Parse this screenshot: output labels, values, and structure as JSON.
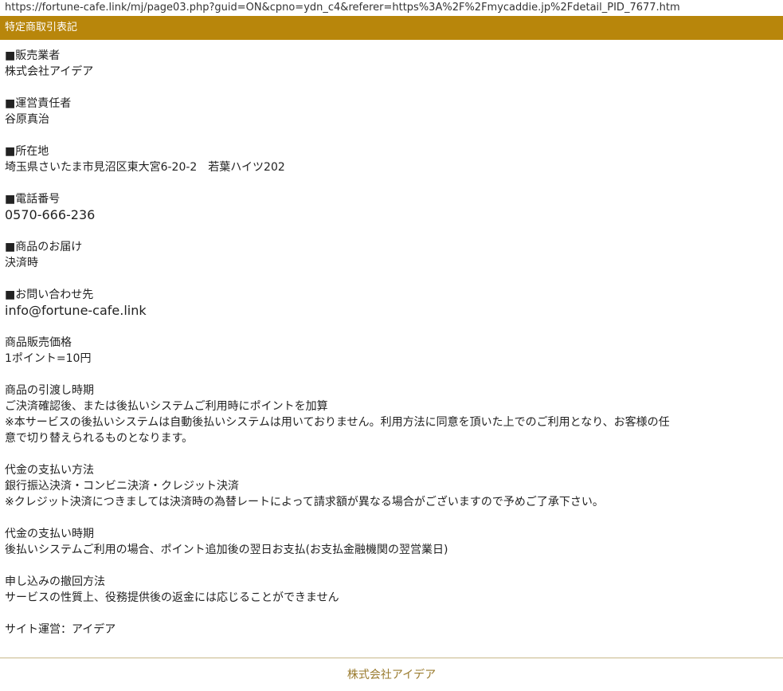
{
  "browser": {
    "url": "https://fortune-cafe.link/mj/page03.php?guid=ON&cpno=ydn_c4&referer=https%3A%2F%2Fmycaddie.jp%2Fdetail_PID_7677.htm"
  },
  "header": {
    "title": "特定商取引表記"
  },
  "sections": {
    "seller": {
      "heading": "■販売業者",
      "lines": [
        "株式会社アイデア"
      ]
    },
    "manager": {
      "heading": "■運営責任者",
      "lines": [
        "谷原真治"
      ]
    },
    "address": {
      "heading": "■所在地",
      "lines": [
        "埼玉県さいたま市見沼区東大宮6-20-2　若葉ハイツ202"
      ]
    },
    "phone": {
      "heading": "■電話番号",
      "lines": [
        "0570-666-236"
      ]
    },
    "delivery": {
      "heading": "■商品のお届け",
      "lines": [
        "決済時"
      ]
    },
    "contact": {
      "heading": "■お問い合わせ先",
      "lines": [
        "info@fortune-cafe.link"
      ]
    },
    "price": {
      "heading": "商品販売価格",
      "lines": [
        "1ポイント=10円"
      ]
    },
    "handover": {
      "heading": "商品の引渡し時期",
      "lines": [
        "ご決済確認後、または後払いシステムご利用時にポイントを加算",
        "※本サービスの後払いシステムは自動後払いシステムは用いておりません。利用方法に同意を頂いた上でのご利用となり、お客様の任",
        "意で切り替えられるものとなります。"
      ]
    },
    "payment_method": {
      "heading": "代金の支払い方法",
      "lines": [
        "銀行振込決済・コンビニ決済・クレジット決済",
        "※クレジット決済につきましては決済時の為替レートによって請求額が異なる場合がございますので予めご了承下さい。"
      ]
    },
    "payment_timing": {
      "heading": "代金の支払い時期",
      "lines": [
        "後払いシステムご利用の場合、ポイント追加後の翌日お支払(お支払金融機関の翌営業日)"
      ]
    },
    "cancellation": {
      "heading": "申し込みの撤回方法",
      "lines": [
        "サービスの性質上、役務提供後の返金には応じることができません"
      ]
    },
    "operator": {
      "heading": "",
      "lines": [
        "サイト運営：アイデア"
      ]
    }
  },
  "footer": {
    "company": "株式会社アイデア"
  },
  "colors": {
    "header_bg": "#b8860b",
    "footer_text": "#9a7b2e"
  }
}
